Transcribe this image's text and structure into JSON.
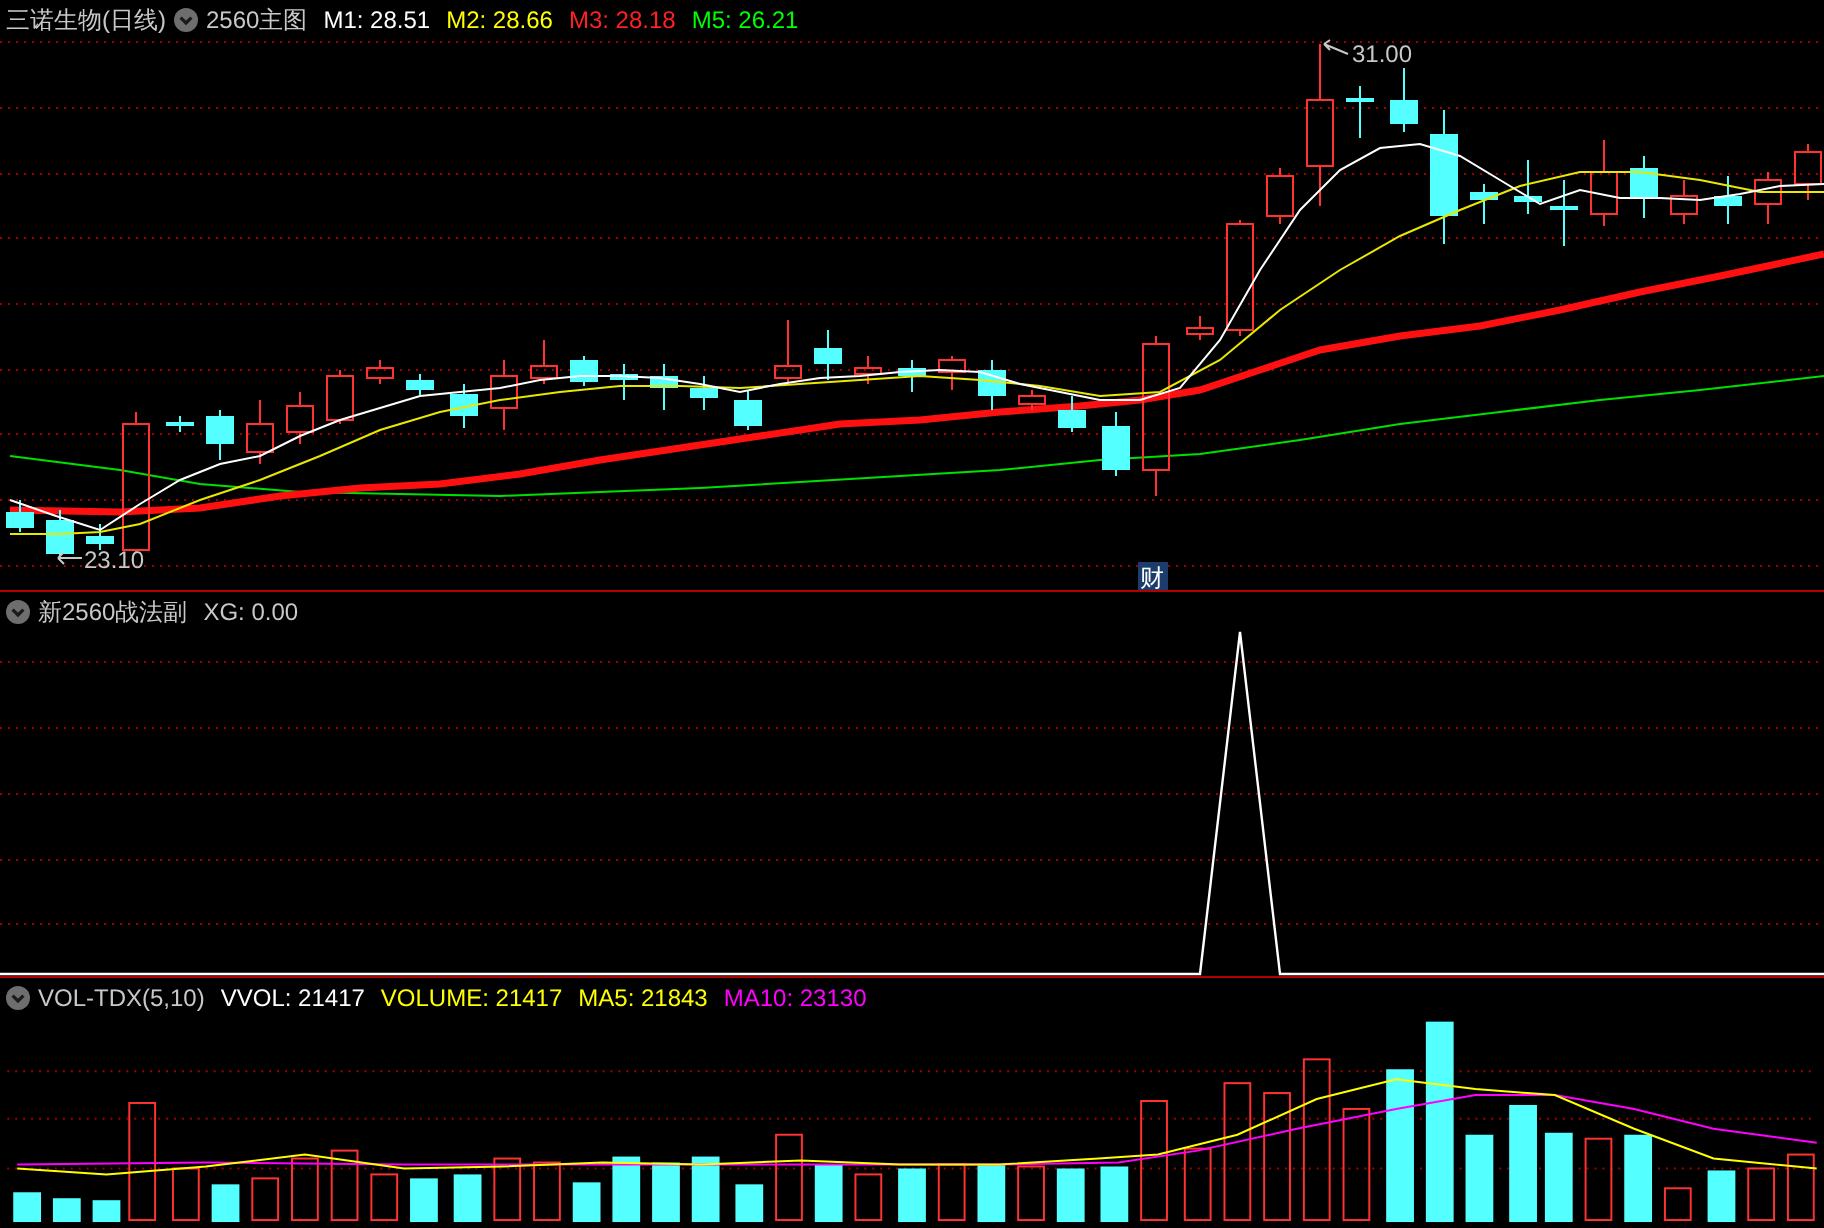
{
  "main_panel": {
    "security": "三诺生物(日线)",
    "indicator": "2560主图",
    "legends": [
      {
        "label": "M1: 28.51",
        "color": "#ffffff"
      },
      {
        "label": "M2: 28.66",
        "color": "#ffff00"
      },
      {
        "label": "M3: 28.18",
        "color": "#ff2020"
      },
      {
        "label": "M5: 26.21",
        "color": "#00ff00"
      }
    ],
    "high_label": "31.00",
    "low_label": "23.10",
    "event_marker": "财"
  },
  "sub_panel": {
    "indicator": "新2560战法副",
    "legends": [
      {
        "label": "XG: 0.00",
        "color": "#c8c8c8"
      }
    ]
  },
  "volume_panel": {
    "indicator": "VOL-TDX(5,10)",
    "legends": [
      {
        "label": "VVOL: 21417",
        "color": "#ffffff"
      },
      {
        "label": "VOLUME: 21417",
        "color": "#ffff00"
      },
      {
        "label": "MA5: 21843",
        "color": "#ffff00"
      },
      {
        "label": "MA10: 23130",
        "color": "#ff00ff"
      }
    ]
  }
}
